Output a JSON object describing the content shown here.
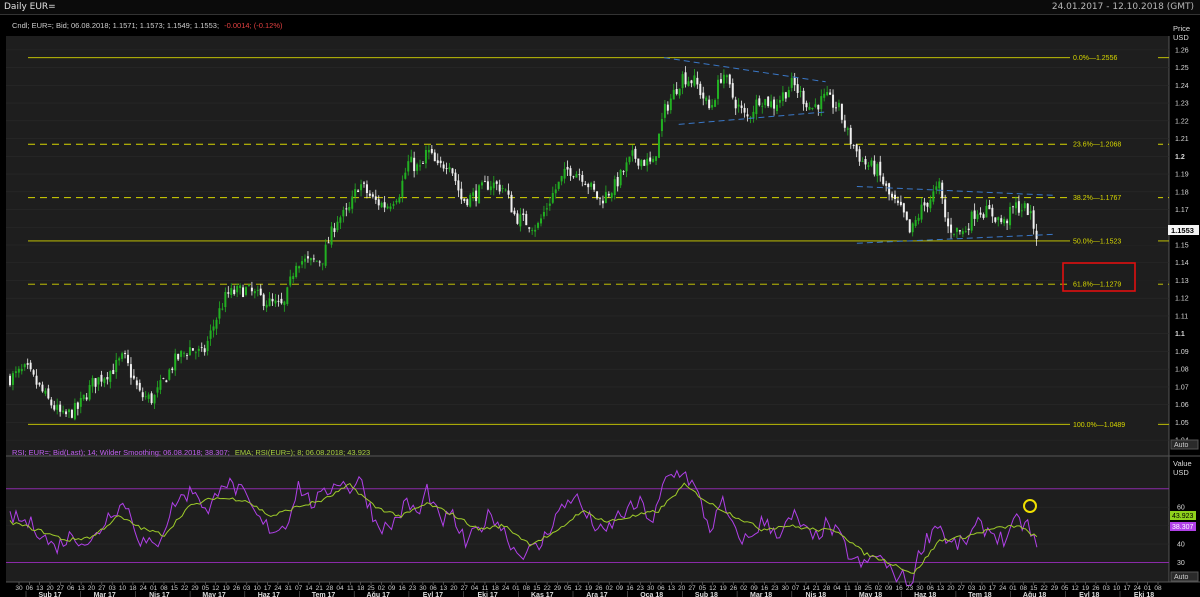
{
  "window": {
    "title": "Daily EUR=",
    "date_range": "24.01.2017 - 12.10.2018 (GMT)"
  },
  "main_panel": {
    "legend_prefix": "Cndl; EUR=; Bid; 06.08.2018; 1.1571; 1.1573; 1.1549; 1.1553;",
    "legend_change": "-0.0014; (-0.12%)",
    "axis_title": [
      "Price",
      "USD"
    ],
    "last_price_label": "1.1553",
    "auto_label": "Auto"
  },
  "rsi_panel": {
    "legend_rsi": "RSI; EUR=; Bid(Last); 14; Wilder Smoothing; 06.08.2018; 38.307;",
    "legend_ema": "EMA; RSI(EUR=); 8; 06.08.2018; 43.923",
    "axis_title": [
      "Value",
      "USD"
    ],
    "ema_value_label": "43.923",
    "rsi_value_label": "38.307",
    "auto_label": "Auto"
  },
  "x_axis": {
    "day_labels": [
      "30",
      "06",
      "13",
      "20",
      "27",
      "06",
      "13",
      "20",
      "27",
      "03",
      "10",
      "18",
      "24",
      "01",
      "08",
      "15",
      "22",
      "29",
      "05",
      "12",
      "19",
      "26",
      "03",
      "10",
      "17",
      "24",
      "31",
      "07",
      "14",
      "21",
      "28",
      "04",
      "11",
      "18",
      "25",
      "02",
      "09",
      "16",
      "23",
      "30",
      "06",
      "13",
      "20",
      "27",
      "04",
      "11",
      "18",
      "24",
      "01",
      "08",
      "15",
      "22",
      "29",
      "05",
      "12",
      "19",
      "26",
      "02",
      "09",
      "16",
      "23",
      "30",
      "06",
      "13",
      "20",
      "27",
      "05",
      "12",
      "19",
      "26",
      "02",
      "09",
      "16",
      "23",
      "30",
      "07",
      "14",
      "21",
      "28",
      "04",
      "11",
      "18",
      "25",
      "02",
      "09",
      "16",
      "23",
      "30",
      "06",
      "13",
      "20",
      "27",
      "03",
      "10",
      "17",
      "24",
      "01",
      "08",
      "15",
      "22",
      "29",
      "05",
      "12",
      "19",
      "26",
      "03",
      "10",
      "17",
      "24",
      "01",
      "08"
    ],
    "month_labels": [
      "Şub 17",
      "Mar 17",
      "Nis 17",
      "May 17",
      "Haz 17",
      "Tem 17",
      "Ağu 17",
      "Eyl 17",
      "Eki 17",
      "Kas 17",
      "Ara 17",
      "Oca 18",
      "Şub 18",
      "Mar 18",
      "Nis 18",
      "May 18",
      "Haz 18",
      "Tem 18",
      "Ağu 18",
      "Eyl 18",
      "Eki 18"
    ]
  },
  "highlight_box_color": "#e01010",
  "colors": {
    "up_candle": "#22b022",
    "down_candle": "#f0f0f0",
    "fib_line": "#d6d600",
    "trend_line": "#3a78c8",
    "rsi_line": "#b040e8",
    "ema_line": "#9ecb2a",
    "rsi_band": "#8a2aa8",
    "change_text": "#e04040"
  },
  "chart_data": [
    {
      "type": "candlestick",
      "series_name": "EUR= Bid",
      "y_range": [
        1.035,
        1.265
      ],
      "y_ticks": [
        "1.26",
        "1.25",
        "1.24",
        "1.23",
        "1.22",
        "1.21",
        "1.2",
        "1.19",
        "1.18",
        "1.17",
        "1.16",
        "1.15",
        "1.14",
        "1.13",
        "1.12",
        "1.11",
        "1.1",
        "1.09",
        "1.08",
        "1.07",
        "1.06",
        "1.05",
        "1.04"
      ],
      "x_range": [
        "2017-01-24",
        "2018-10-12"
      ],
      "last": {
        "date": "2018-08-06",
        "open": 1.1571,
        "high": 1.1573,
        "low": 1.1549,
        "close": 1.1553,
        "change": -0.0014,
        "change_pct": -0.12
      },
      "fibonacci": [
        {
          "label": "0.0%",
          "value": 1.2556,
          "value_text": "1.2556",
          "style": "solid"
        },
        {
          "label": "23.6%",
          "value": 1.2068,
          "value_text": "1.2068",
          "style": "dashed"
        },
        {
          "label": "38.2%",
          "value": 1.1767,
          "value_text": "1.1767",
          "style": "dashed"
        },
        {
          "label": "50.0%",
          "value": 1.1523,
          "value_text": "1.1523",
          "style": "solid"
        },
        {
          "label": "61.8%",
          "value": 1.1279,
          "value_text": "1.1279",
          "style": "dashed"
        },
        {
          "label": "100.0%",
          "value": 1.0489,
          "value_text": "1.0489",
          "style": "solid"
        }
      ],
      "trend_lines": [
        {
          "from": [
            "2018-01-15",
            1.2556
          ],
          "to": [
            "2018-04-13",
            1.242
          ]
        },
        {
          "from": [
            "2018-01-23",
            1.218
          ],
          "to": [
            "2018-04-13",
            1.225
          ]
        },
        {
          "from": [
            "2018-04-30",
            1.183
          ],
          "to": [
            "2018-08-15",
            1.178
          ]
        },
        {
          "from": [
            "2018-04-30",
            1.151
          ],
          "to": [
            "2018-08-15",
            1.156
          ]
        }
      ],
      "close_path": [
        [
          "2017-01-24",
          1.075
        ],
        [
          "2017-02-02",
          1.08
        ],
        [
          "2017-02-14",
          1.062
        ],
        [
          "2017-02-22",
          1.053
        ],
        [
          "2017-03-02",
          1.058
        ],
        [
          "2017-03-10",
          1.072
        ],
        [
          "2017-03-21",
          1.08
        ],
        [
          "2017-03-27",
          1.087
        ],
        [
          "2017-04-05",
          1.065
        ],
        [
          "2017-04-12",
          1.063
        ],
        [
          "2017-04-24",
          1.085
        ],
        [
          "2017-05-02",
          1.092
        ],
        [
          "2017-05-09",
          1.088
        ],
        [
          "2017-05-16",
          1.108
        ],
        [
          "2017-05-22",
          1.122
        ],
        [
          "2017-06-01",
          1.125
        ],
        [
          "2017-06-08",
          1.121
        ],
        [
          "2017-06-15",
          1.117
        ],
        [
          "2017-06-22",
          1.115
        ],
        [
          "2017-06-29",
          1.142
        ],
        [
          "2017-07-06",
          1.14
        ],
        [
          "2017-07-13",
          1.142
        ],
        [
          "2017-07-21",
          1.165
        ],
        [
          "2017-07-27",
          1.168
        ],
        [
          "2017-08-02",
          1.185
        ],
        [
          "2017-08-10",
          1.175
        ],
        [
          "2017-08-17",
          1.172
        ],
        [
          "2017-08-24",
          1.18
        ],
        [
          "2017-08-29",
          1.197
        ],
        [
          "2017-09-05",
          1.192
        ],
        [
          "2017-09-08",
          1.204
        ],
        [
          "2017-09-14",
          1.193
        ],
        [
          "2017-09-20",
          1.198
        ],
        [
          "2017-09-27",
          1.175
        ],
        [
          "2017-10-04",
          1.178
        ],
        [
          "2017-10-12",
          1.185
        ],
        [
          "2017-10-20",
          1.182
        ],
        [
          "2017-10-26",
          1.166
        ],
        [
          "2017-11-07",
          1.16
        ],
        [
          "2017-11-15",
          1.178
        ],
        [
          "2017-11-24",
          1.193
        ],
        [
          "2017-12-01",
          1.19
        ],
        [
          "2017-12-11",
          1.175
        ],
        [
          "2017-12-19",
          1.183
        ],
        [
          "2017-12-29",
          1.2
        ],
        [
          "2018-01-09",
          1.195
        ],
        [
          "2018-01-15",
          1.225
        ],
        [
          "2018-01-25",
          1.245
        ],
        [
          "2018-02-01",
          1.242
        ],
        [
          "2018-02-09",
          1.226
        ],
        [
          "2018-02-16",
          1.248
        ],
        [
          "2018-02-22",
          1.232
        ],
        [
          "2018-03-01",
          1.221
        ],
        [
          "2018-03-08",
          1.233
        ],
        [
          "2018-03-16",
          1.229
        ],
        [
          "2018-03-26",
          1.241
        ],
        [
          "2018-04-05",
          1.227
        ],
        [
          "2018-04-13",
          1.233
        ],
        [
          "2018-04-20",
          1.227
        ],
        [
          "2018-04-26",
          1.21
        ],
        [
          "2018-05-03",
          1.197
        ],
        [
          "2018-05-11",
          1.192
        ],
        [
          "2018-05-18",
          1.177
        ],
        [
          "2018-05-25",
          1.168
        ],
        [
          "2018-05-29",
          1.156
        ],
        [
          "2018-06-04",
          1.17
        ],
        [
          "2018-06-14",
          1.183
        ],
        [
          "2018-06-18",
          1.16
        ],
        [
          "2018-06-27",
          1.157
        ],
        [
          "2018-07-04",
          1.17
        ],
        [
          "2018-07-12",
          1.168
        ],
        [
          "2018-07-19",
          1.162
        ],
        [
          "2018-07-25",
          1.172
        ],
        [
          "2018-08-01",
          1.17
        ],
        [
          "2018-08-06",
          1.1553
        ]
      ]
    },
    {
      "type": "line",
      "series": [
        {
          "name": "RSI",
          "indicator": "RSI 14 Wilder Smoothing",
          "last": 38.307
        },
        {
          "name": "EMA",
          "indicator": "EMA 8 of RSI",
          "last": 43.923
        }
      ],
      "y_ticks": [
        "60",
        "50",
        "40",
        "30"
      ],
      "y_range": [
        20,
        85
      ],
      "bands": [
        70,
        30
      ],
      "rsi_path": [
        [
          "2017-01-24",
          55
        ],
        [
          "2017-02-06",
          50
        ],
        [
          "2017-02-17",
          38
        ],
        [
          "2017-02-27",
          45
        ],
        [
          "2017-03-09",
          40
        ],
        [
          "2017-03-20",
          58
        ],
        [
          "2017-03-28",
          62
        ],
        [
          "2017-04-05",
          42
        ],
        [
          "2017-04-13",
          38
        ],
        [
          "2017-04-24",
          63
        ],
        [
          "2017-05-05",
          70
        ],
        [
          "2017-05-12",
          55
        ],
        [
          "2017-05-19",
          75
        ],
        [
          "2017-05-30",
          68
        ],
        [
          "2017-06-09",
          52
        ],
        [
          "2017-06-16",
          48
        ],
        [
          "2017-06-23",
          50
        ],
        [
          "2017-06-30",
          72
        ],
        [
          "2017-07-07",
          62
        ],
        [
          "2017-07-14",
          66
        ],
        [
          "2017-07-21",
          75
        ],
        [
          "2017-07-28",
          70
        ],
        [
          "2017-08-02",
          76
        ],
        [
          "2017-08-11",
          52
        ],
        [
          "2017-08-18",
          48
        ],
        [
          "2017-08-28",
          62
        ],
        [
          "2017-09-04",
          56
        ],
        [
          "2017-09-08",
          70
        ],
        [
          "2017-09-15",
          52
        ],
        [
          "2017-09-22",
          55
        ],
        [
          "2017-09-29",
          40
        ],
        [
          "2017-10-06",
          48
        ],
        [
          "2017-10-13",
          57
        ],
        [
          "2017-10-20",
          47
        ],
        [
          "2017-10-27",
          35
        ],
        [
          "2017-11-08",
          38
        ],
        [
          "2017-11-17",
          55
        ],
        [
          "2017-11-27",
          67
        ],
        [
          "2017-12-04",
          55
        ],
        [
          "2017-12-13",
          45
        ],
        [
          "2017-12-21",
          55
        ],
        [
          "2018-01-02",
          62
        ],
        [
          "2018-01-09",
          52
        ],
        [
          "2018-01-16",
          75
        ],
        [
          "2018-01-25",
          80
        ],
        [
          "2018-02-01",
          70
        ],
        [
          "2018-02-09",
          48
        ],
        [
          "2018-02-16",
          62
        ],
        [
          "2018-02-23",
          45
        ],
        [
          "2018-03-02",
          42
        ],
        [
          "2018-03-09",
          52
        ],
        [
          "2018-03-19",
          46
        ],
        [
          "2018-03-27",
          55
        ],
        [
          "2018-04-06",
          42
        ],
        [
          "2018-04-13",
          50
        ],
        [
          "2018-04-20",
          45
        ],
        [
          "2018-04-27",
          32
        ],
        [
          "2018-05-04",
          28
        ],
        [
          "2018-05-11",
          35
        ],
        [
          "2018-05-18",
          25
        ],
        [
          "2018-05-25",
          22
        ],
        [
          "2018-05-29",
          18
        ],
        [
          "2018-06-04",
          38
        ],
        [
          "2018-06-13",
          52
        ],
        [
          "2018-06-19",
          40
        ],
        [
          "2018-06-27",
          40
        ],
        [
          "2018-07-05",
          50
        ],
        [
          "2018-07-12",
          47
        ],
        [
          "2018-07-19",
          42
        ],
        [
          "2018-07-26",
          52
        ],
        [
          "2018-08-01",
          50
        ],
        [
          "2018-08-06",
          38.307
        ]
      ],
      "ema_path": [
        [
          "2017-01-24",
          52
        ],
        [
          "2017-02-10",
          47
        ],
        [
          "2017-02-24",
          42
        ],
        [
          "2017-03-10",
          44
        ],
        [
          "2017-03-24",
          55
        ],
        [
          "2017-04-07",
          48
        ],
        [
          "2017-04-18",
          45
        ],
        [
          "2017-05-01",
          60
        ],
        [
          "2017-05-15",
          65
        ],
        [
          "2017-06-01",
          64
        ],
        [
          "2017-06-15",
          55
        ],
        [
          "2017-06-29",
          60
        ],
        [
          "2017-07-14",
          64
        ],
        [
          "2017-07-28",
          72
        ],
        [
          "2017-08-11",
          60
        ],
        [
          "2017-08-25",
          55
        ],
        [
          "2017-09-08",
          62
        ],
        [
          "2017-09-22",
          56
        ],
        [
          "2017-10-06",
          48
        ],
        [
          "2017-10-20",
          50
        ],
        [
          "2017-11-03",
          40
        ],
        [
          "2017-11-17",
          46
        ],
        [
          "2017-12-01",
          58
        ],
        [
          "2017-12-15",
          52
        ],
        [
          "2017-12-29",
          55
        ],
        [
          "2018-01-12",
          58
        ],
        [
          "2018-01-26",
          72
        ],
        [
          "2018-02-09",
          62
        ],
        [
          "2018-02-23",
          55
        ],
        [
          "2018-03-09",
          48
        ],
        [
          "2018-03-23",
          50
        ],
        [
          "2018-04-06",
          48
        ],
        [
          "2018-04-20",
          47
        ],
        [
          "2018-05-04",
          35
        ],
        [
          "2018-05-18",
          30
        ],
        [
          "2018-05-31",
          24
        ],
        [
          "2018-06-14",
          42
        ],
        [
          "2018-06-28",
          44
        ],
        [
          "2018-07-12",
          48
        ],
        [
          "2018-07-26",
          50
        ],
        [
          "2018-08-06",
          43.923
        ]
      ]
    }
  ]
}
